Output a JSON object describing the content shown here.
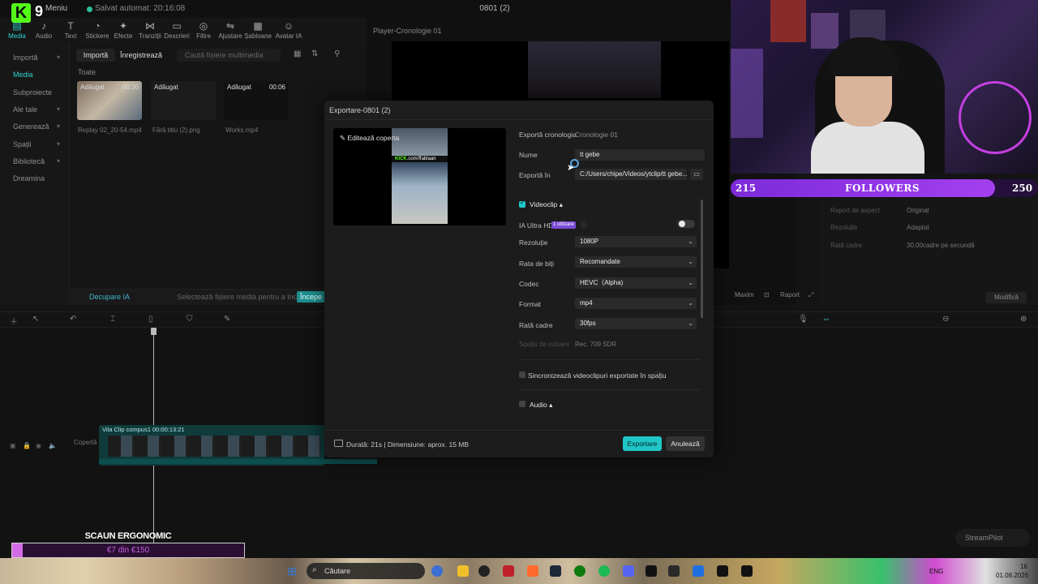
{
  "topbar": {
    "menu": "Meniu",
    "autosave": "Salvat automat: 20:16:08",
    "project_title": "0801 (2)"
  },
  "toolbar": {
    "items": [
      {
        "label": "Media",
        "icon": "media-icon"
      },
      {
        "label": "Audio",
        "icon": "audio-icon"
      },
      {
        "label": "Text",
        "icon": "text-icon"
      },
      {
        "label": "Stickere",
        "icon": "sticker-icon"
      },
      {
        "label": "Efecte",
        "icon": "effects-icon"
      },
      {
        "label": "Tranziții",
        "icon": "transitions-icon"
      },
      {
        "label": "Descrieri",
        "icon": "captions-icon"
      },
      {
        "label": "Filtre",
        "icon": "filters-icon"
      },
      {
        "label": "Ajustare",
        "icon": "adjust-icon"
      },
      {
        "label": "Șabloane",
        "icon": "templates-icon"
      },
      {
        "label": "Avatar IA",
        "icon": "avatar-icon"
      }
    ]
  },
  "leftnav": {
    "items": [
      "Importă",
      "Media",
      "Subproiecte",
      "Ale tale",
      "Generează",
      "Spații",
      "Bibliotecă",
      "Dreamina"
    ]
  },
  "media": {
    "import": "Importă",
    "record": "Înregistrează",
    "search_placeholder": "Caută fișiere multimedia",
    "all": "Toate",
    "thumbs": [
      {
        "tag": "Adăugat",
        "duration": "00:30",
        "name": "Replay 02_20-54.mp4"
      },
      {
        "tag": "Adăugat",
        "duration": "",
        "name": "Fără titlu (2).png"
      },
      {
        "tag": "Adăugat",
        "duration": "00:06",
        "name": "Works.mp4"
      }
    ],
    "ai_cut": "Decupare IA",
    "ai_hint": "Selectează fișiere media pentru a începe",
    "ai_start": "Începe d"
  },
  "player": {
    "title": "Player-Cronologie 01",
    "controls": [
      "Maxim",
      "Raport"
    ]
  },
  "props": {
    "rows": [
      {
        "label": "Raport de aspect",
        "value": "Original"
      },
      {
        "label": "Rezoluție",
        "value": "Adaptat"
      },
      {
        "label": "Rată cadre",
        "value": "30.00cadre pe secundă"
      }
    ],
    "modify": "Modifică"
  },
  "timeline": {
    "track_label": "Vila    Clip compus1  00:00:13:21",
    "cover": "Copertă"
  },
  "dialog": {
    "title": "Exportare-0801 (2)",
    "edit_cover": "Editează coperta",
    "export_timeline_label": "Exportă cronologia",
    "export_timeline_value": "Cronologie 01",
    "name_label": "Nume",
    "name_value": "tt gebe",
    "export_to_label": "Exportă în",
    "export_to_value": "C:/Users/chipe/Videos/ytclip/tt gebe...",
    "videoclip_label": "Videoclip ▴",
    "ai_hd_label": "IA Ultra HD",
    "ai_hd_badge": "1 utilizare",
    "resolution_label": "Rezoluție",
    "resolution_value": "1080P",
    "bitrate_label": "Rata de biți",
    "bitrate_value": "Recomandate",
    "codec_label": "Codec",
    "codec_value": "HEVC（Alpha)",
    "format_label": "Format",
    "format_value": "mp4",
    "framerate_label": "Rată cadre",
    "framerate_value": "30fps",
    "colorspace_label": "Spațiu de culoare",
    "colorspace_value": "Rec. 709 SDR",
    "sync_label": "Sincronizează videoclipuri exportate în spațiu",
    "audio_label": "Audio ▴",
    "duration": "Durată: 21s | Dimensiune: aprox. 15 MB",
    "export_button": "Exportare",
    "cancel_button": "Anulează",
    "cover_kick": "KICK",
    "cover_kick_handle": ".com/ffablaan"
  },
  "overlays": {
    "kick_logo": "K",
    "kick_count": "9",
    "followers_current": "215",
    "followers_label": "FOLLOWERS",
    "followers_goal": "250",
    "followers_progress": 0.86,
    "chair_title": "SCAUN ERGONOMIC",
    "chair_progress": "€7 din €150",
    "chair_fraction": 0.047,
    "streampilot": "StreamPilot"
  },
  "taskbar": {
    "search": "Căutare",
    "lang": "ENG",
    "time": "16",
    "date": "01.08.2026"
  },
  "colors": {
    "accent": "#20c6c6",
    "kick": "#53fc18",
    "followers": "#a340ef"
  }
}
